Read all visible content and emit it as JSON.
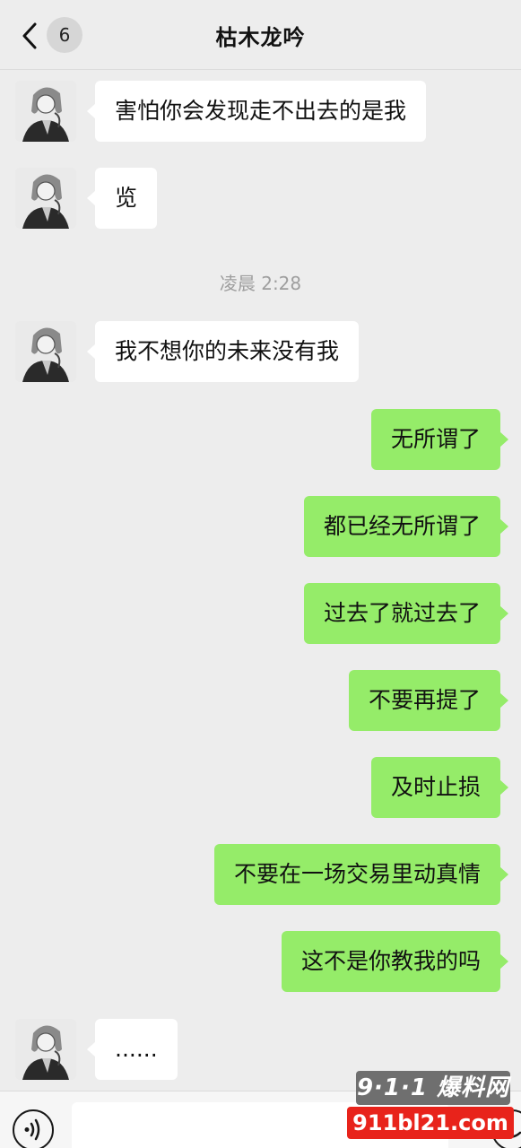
{
  "header": {
    "back_icon": "chevron-left-icon",
    "unread_count": "6",
    "title": "枯木龙吟"
  },
  "messages": [
    {
      "side": "in",
      "text": "害怕你会发现走不出去的是我"
    },
    {
      "side": "in",
      "text": "览"
    },
    {
      "type": "time",
      "text": "凌晨 2:28"
    },
    {
      "side": "in",
      "text": "我不想你的未来没有我"
    },
    {
      "side": "out",
      "text": "无所谓了"
    },
    {
      "side": "out",
      "text": "都已经无所谓了"
    },
    {
      "side": "out",
      "text": "过去了就过去了"
    },
    {
      "side": "out",
      "text": "不要再提了"
    },
    {
      "side": "out",
      "text": "及时止损"
    },
    {
      "side": "out",
      "text": "不要在一场交易里动真情"
    },
    {
      "side": "out",
      "text": "这不是你教我的吗"
    },
    {
      "side": "in",
      "text": "......"
    }
  ],
  "input_bar": {
    "voice_icon": "voice-icon",
    "emoji_icon": "emoji-icon",
    "input_value": ""
  },
  "watermark": {
    "top": "9·1·1 爆料网",
    "bottom": "911bl21.com"
  },
  "colors": {
    "background": "#ededed",
    "incoming_bubble": "#ffffff",
    "outgoing_bubble": "#95ec69"
  }
}
